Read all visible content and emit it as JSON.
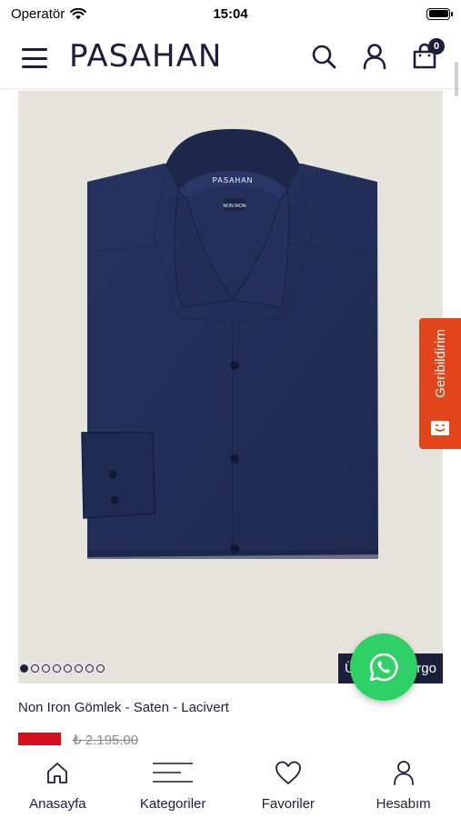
{
  "status_bar": {
    "carrier": "Operatör",
    "time": "15:04"
  },
  "header": {
    "logo": "PASAHAN",
    "cart_count": "0",
    "icons": [
      "menu-icon",
      "search-icon",
      "user-icon",
      "shopping-bag-icon"
    ]
  },
  "product": {
    "name": "Non Iron Gömlek - Saten - Lacivert",
    "old_price": "₺ 2.195,00",
    "image": {
      "brand_label": "PASAHAN",
      "tag_label": "NON IRON",
      "background_color": "#e7e4de",
      "shirt_color": "#232f57"
    },
    "gallery": {
      "total_images": 8,
      "active_index": 0
    },
    "cargo_banner_left": "Ü",
    "cargo_banner_right": "rgo"
  },
  "feedback": {
    "label": "Geribildirim",
    "color": "#e2451c"
  },
  "whatsapp": {
    "icon": "whatsapp-icon",
    "color": "#2fd166"
  },
  "tab_bar": {
    "items": [
      {
        "label": "Anasayfa",
        "icon": "home-icon"
      },
      {
        "label": "Kategoriler",
        "icon": "categories-icon"
      },
      {
        "label": "Favoriler",
        "icon": "heart-icon"
      },
      {
        "label": "Hesabım",
        "icon": "account-icon"
      }
    ]
  },
  "colors": {
    "brand_navy": "#1b1f3b",
    "sale_red": "#d0101a"
  }
}
